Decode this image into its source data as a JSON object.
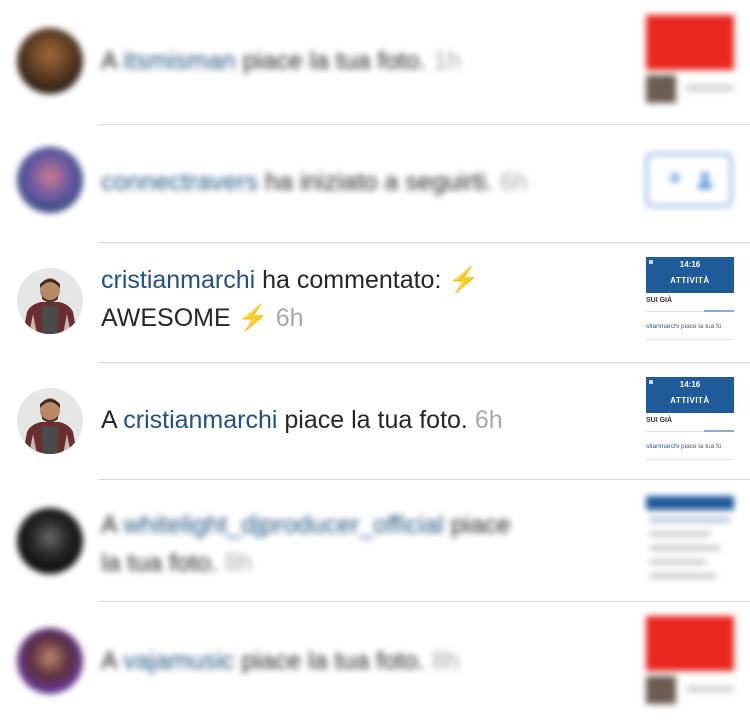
{
  "notifications": [
    {
      "prefix": "A ",
      "username": "itsmisman",
      "body": " piace la tua foto.",
      "time": "1h",
      "avatar_icon": "user-avatar-icon",
      "blurred": true,
      "thumb": "red-photo"
    },
    {
      "prefix": "",
      "username": "connectravers",
      "body": " ha iniziato a seguirti.",
      "time": "6h",
      "avatar_icon": "user-avatar-icon",
      "blurred": true,
      "action": "follow-button"
    },
    {
      "prefix": "",
      "username": "cristianmarchi",
      "body_line1": " ha commentato: ",
      "bolt": "⚡",
      "body_line2": "AWESOME ",
      "time": "6h",
      "avatar_icon": "user-avatar-icon",
      "blurred": false,
      "thumb": "app-screenshot"
    },
    {
      "prefix": "A ",
      "username": "cristianmarchi",
      "body": " piace la tua foto.",
      "time": "6h",
      "avatar_icon": "user-avatar-icon",
      "blurred": false,
      "thumb": "app-screenshot"
    },
    {
      "prefix": "A ",
      "username": "whitelight_djproducer_official",
      "body": " piace",
      "body_line2": "la tua foto.",
      "time": "8h",
      "avatar_icon": "user-avatar-icon",
      "blurred": true,
      "thumb": "list-screenshot"
    },
    {
      "prefix": "A ",
      "username": "vajamusic",
      "body": " piace la tua foto.",
      "time": "8h",
      "avatar_icon": "user-avatar-icon",
      "blurred": true,
      "thumb": "red-photo"
    }
  ],
  "app_screenshot": {
    "clock": "14:16",
    "title": "ATTIVITÀ",
    "section": "SUI GIÀ",
    "line_user": "stianmarchi",
    "line_rest": " piace la tua fo"
  },
  "colors": {
    "username": "#225282",
    "time": "#a8a8a8",
    "text": "#262626",
    "separator": "#d9d9d9",
    "app_bar": "#1f5a99",
    "follow_button": "#5a94d6",
    "bolt": "#f5b400",
    "red_photo": "#e8271f"
  }
}
